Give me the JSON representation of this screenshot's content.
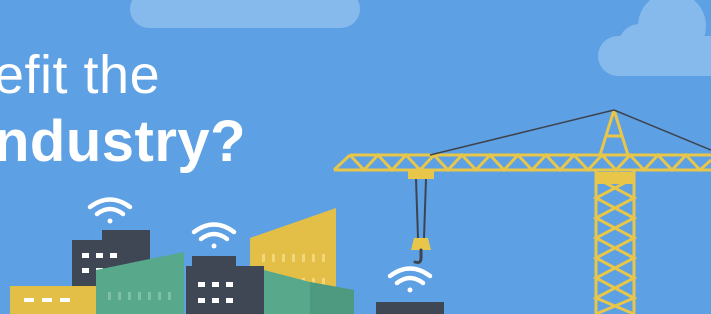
{
  "headline": {
    "line1": "efit the",
    "line2": "ndustry?"
  },
  "colors": {
    "sky": "#5da0e3",
    "cloud": "#86b9ec",
    "crane": "#e8c64a",
    "crane_cable": "#3d4450",
    "hook": "#e8c64a",
    "wifi": "#ffffff",
    "building_dark": "#3f4654",
    "building_green": "#58a88c",
    "building_yellow": "#e3bf47",
    "window": "#ffffff"
  },
  "icons": [
    "cloud-icon",
    "wifi-icon",
    "crane-icon",
    "hook-icon",
    "building-icon"
  ]
}
